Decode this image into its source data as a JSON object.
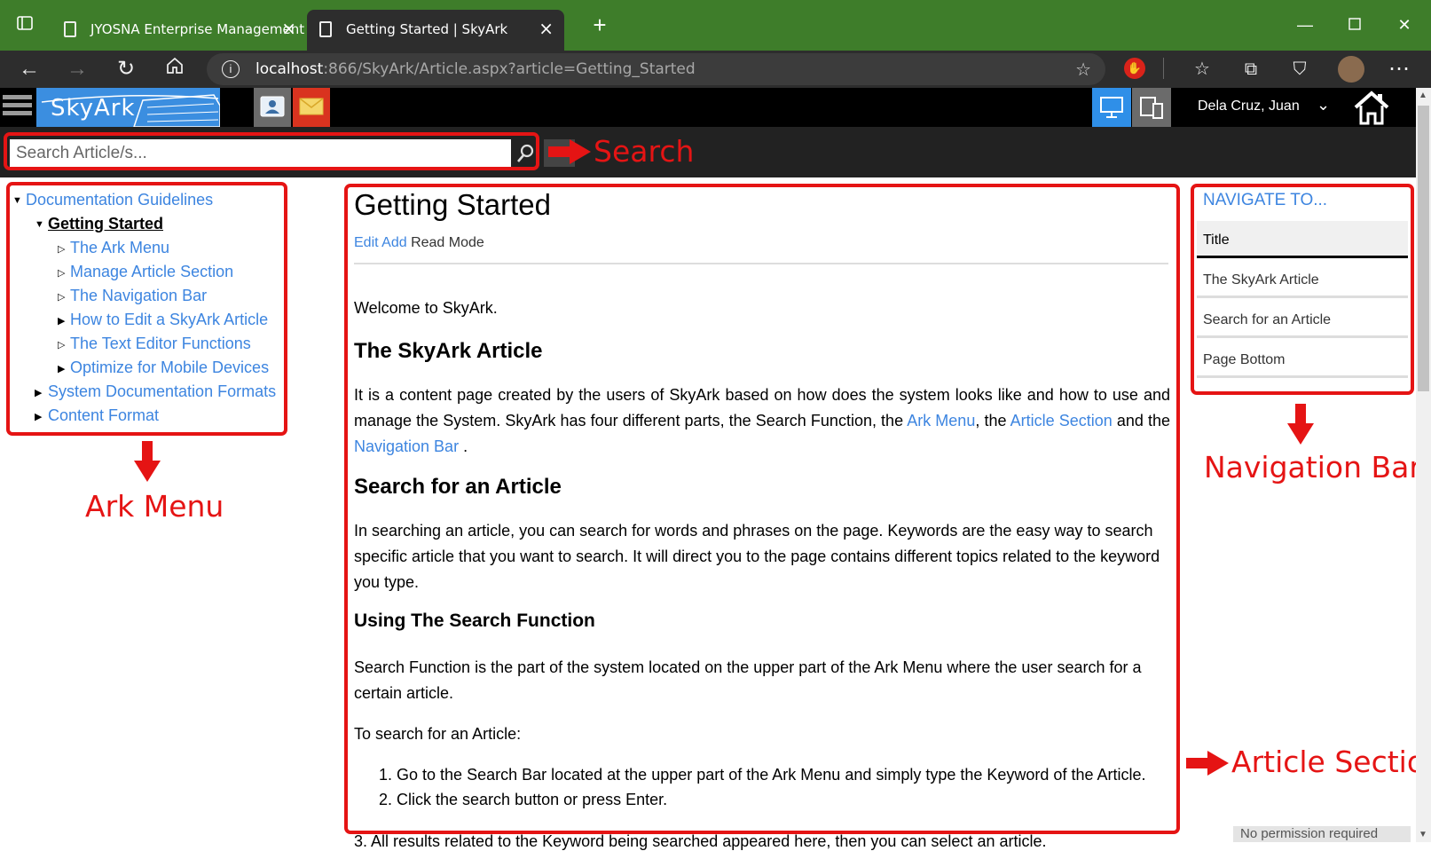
{
  "browser": {
    "tabs": [
      {
        "title": "JYOSNA Enterprise Management"
      },
      {
        "title": "Getting Started | SkyArk"
      }
    ],
    "url_host": "localhost",
    "url_rest": ":866/SkyArk/Article.aspx?article=Getting_Started"
  },
  "header": {
    "logo_text": "SkyArk",
    "user_name": "Dela Cruz, Juan"
  },
  "search": {
    "placeholder": "Search Article/s..."
  },
  "annotations": {
    "search": "Search",
    "ark_menu": "Ark Menu",
    "navigation_bar": "Navigation Bar",
    "article_section": "Article Section"
  },
  "ark_menu": {
    "root": "Documentation Guidelines",
    "current": "Getting Started",
    "children": [
      "The Ark Menu",
      "Manage Article Section",
      "The Navigation Bar",
      "How to Edit a SkyArk Article",
      "The Text Editor Functions",
      "Optimize for Mobile Devices"
    ],
    "siblings": [
      "System Documentation Formats",
      "Content Format"
    ]
  },
  "article": {
    "title": "Getting Started",
    "actions": {
      "edit": "Edit",
      "add": "Add",
      "mode": "Read Mode"
    },
    "welcome": "Welcome to SkyArk.",
    "h_article": "The SkyArk Article",
    "p_article_1": "It is a content page created by the users of SkyArk based on how does the system looks like and how to use and manage the System. SkyArk has four different parts, the Search Function, the ",
    "link_ark_menu": "Ark Menu",
    "p_article_2": ", the ",
    "link_article_section": "Article Section",
    "p_article_3": " and  the ",
    "link_navigation_bar": "Navigation Bar",
    "p_article_4": " .",
    "h_search": "Search for an Article",
    "p_search": "In searching an article, you can search for words and phrases on the page. Keywords are the easy way to search specific article that you want to search. It will direct you to the page contains different topics related to the keyword you type.",
    "h_using": "Using The Search Function",
    "p_using": "Search Function is the part of the system located on the upper part of the Ark Menu where the user search for a certain article.",
    "p_to_search": "To search for an Article:",
    "steps": [
      "Go to the Search Bar located at the upper part of the Ark Menu and simply type the Keyword of the Article.",
      "Click the search button or press Enter."
    ],
    "cut_line": "3. All results related to the Keyword being searched appeared here, then you can select an article."
  },
  "navigate_to": {
    "heading": "NAVIGATE TO...",
    "items": [
      "Title",
      "The SkyArk Article",
      "Search for an Article",
      "Page Bottom"
    ]
  },
  "status": {
    "permission": "No permission required"
  }
}
